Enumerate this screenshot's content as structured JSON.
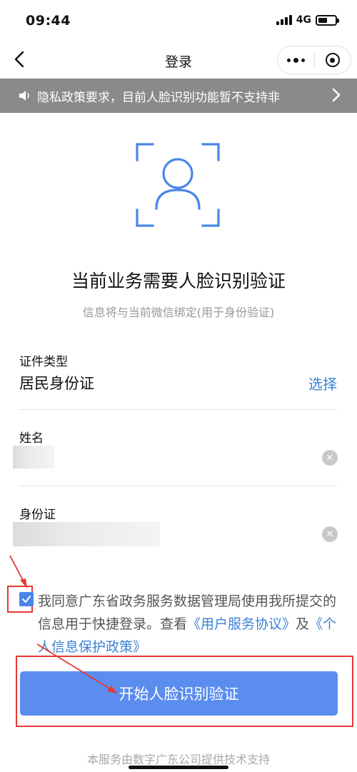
{
  "status_bar": {
    "time": "09:44",
    "network": "4G",
    "battery_level": 0.55
  },
  "nav": {
    "title": "登录"
  },
  "notice": {
    "text": "隐私政策要求，目前人脸识别功能暂不支持非"
  },
  "heading": {
    "title": "当前业务需要人脸识别验证",
    "subtitle": "信息将与当前微信绑定(用于身份验证)"
  },
  "form": {
    "id_type_label": "证件类型",
    "id_type_value": "居民身份证",
    "select_label": "选择",
    "name_label": "姓名",
    "id_label": "身份证"
  },
  "agreement": {
    "text": "我同意广东省政务服务数据管理局使用我所提交的信息用于快捷登录。查看",
    "link_user": "《用户服务协议》",
    "connector": "及",
    "link_privacy": "《个人信息保护政策》",
    "checked": true
  },
  "button": {
    "label": "开始人脸识别验证"
  },
  "footer": {
    "text": "本服务由数字广东公司提供技术支持"
  },
  "colors": {
    "accent": "#5b8def",
    "link": "#3b82d6",
    "annotation": "#e53935",
    "notice_bg": "#8a8a8a"
  }
}
